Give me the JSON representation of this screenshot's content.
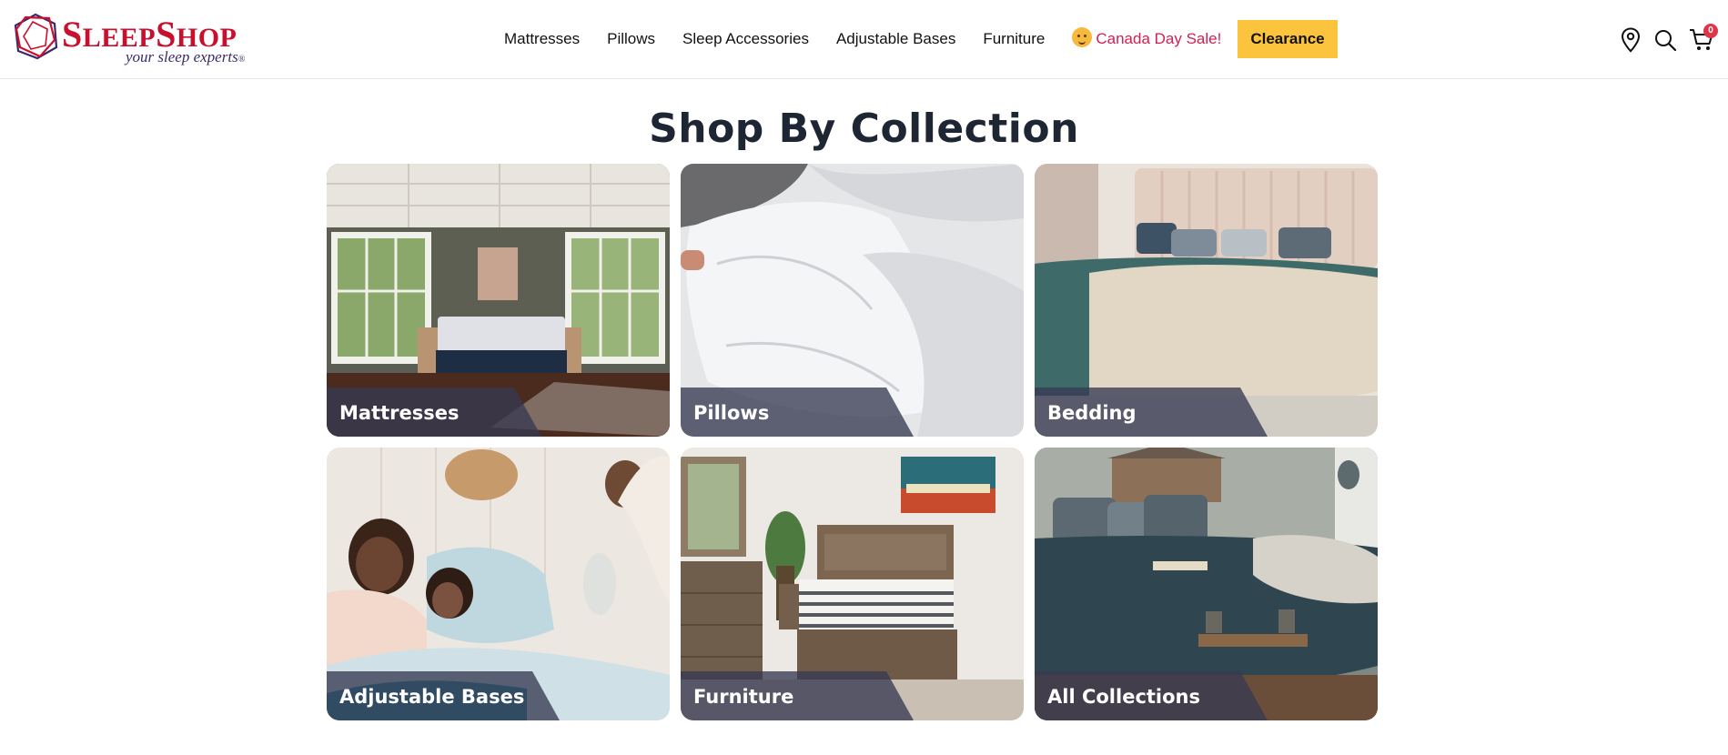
{
  "brand": {
    "name_first_initial": "S",
    "name_first_rest": "LEEP",
    "name_second_initial": "S",
    "name_second_rest": "HOP",
    "tagline": "your sleep experts",
    "tagline_mark": "®",
    "primary_color": "#c8102e",
    "tagline_color": "#3a2a6b"
  },
  "nav": {
    "items": [
      {
        "label": "Mattresses"
      },
      {
        "label": "Pillows"
      },
      {
        "label": "Sleep Accessories"
      },
      {
        "label": "Adjustable Bases"
      },
      {
        "label": "Furniture"
      }
    ],
    "sale": {
      "label": "Canada Day Sale!",
      "icon": "party-face-emoji",
      "color": "#d32050"
    },
    "clearance": {
      "label": "Clearance",
      "background": "#fcc43d"
    }
  },
  "utility": {
    "store_locator_icon": "map-pin-icon",
    "search_icon": "search-icon",
    "cart_icon": "cart-icon",
    "cart_count": "0"
  },
  "main": {
    "title": "Shop By Collection",
    "collections": [
      {
        "label": "Mattresses",
        "image": "bedroom-mattress-photo"
      },
      {
        "label": "Pillows",
        "image": "white-pillows-photo"
      },
      {
        "label": "Bedding",
        "image": "bed-with-bedding-photo"
      },
      {
        "label": "Adjustable Bases",
        "image": "family-on-bed-photo"
      },
      {
        "label": "Furniture",
        "image": "wooden-bedroom-set-photo"
      },
      {
        "label": "All Collections",
        "image": "bedroom-lake-view-photo"
      }
    ]
  }
}
